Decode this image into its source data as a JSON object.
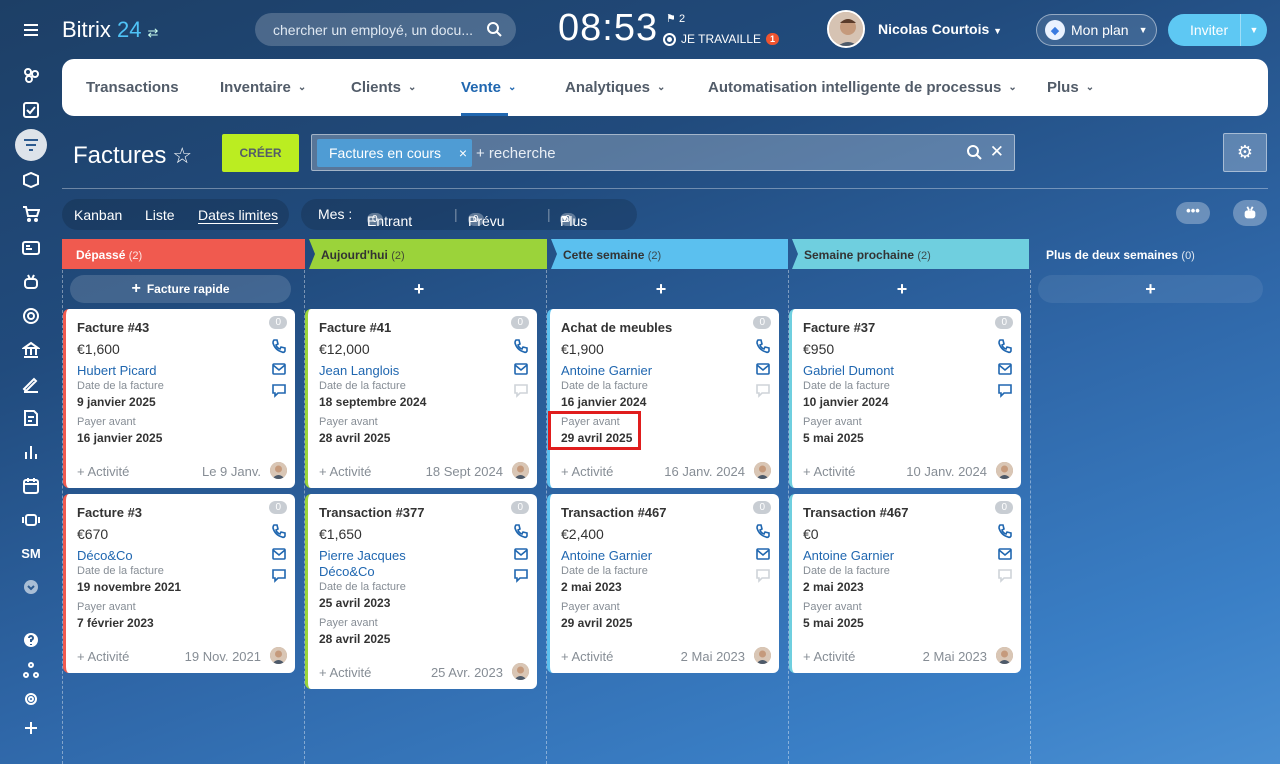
{
  "header": {
    "brand": "Bitrix",
    "brand_num": "24",
    "search_placeholder": "chercher un employé, un docu...",
    "clock": "08:53",
    "flag_count": "2",
    "work_status": "JE TRAVAILLE",
    "work_badge": "1",
    "user_name": "Nicolas Courtois",
    "plan_label": "Mon plan",
    "invite_label": "Inviter"
  },
  "sidebar": {
    "sm_label": "SM"
  },
  "tabs": [
    {
      "label": "Transactions"
    },
    {
      "label": "Inventaire"
    },
    {
      "label": "Clients"
    },
    {
      "label": "Vente"
    },
    {
      "label": "Analytiques"
    },
    {
      "label": "Automatisation intelligente de processus"
    },
    {
      "label": "Plus"
    }
  ],
  "page": {
    "title": "Factures",
    "create_label": "CRÉER",
    "filter_chip": "Factures en cours",
    "filter_placeholder": "+ recherche"
  },
  "views": {
    "kanban": "Kanban",
    "list": "Liste",
    "deadlines": "Dates limites"
  },
  "mes": {
    "label": "Mes :",
    "entrant_count": "0",
    "entrant": "Entrant",
    "prevu_count": "0",
    "prevu": "Prévu",
    "plus_count": "0",
    "plus": "Plus"
  },
  "columns": [
    {
      "title": "Dépassé",
      "count": "(2)",
      "color": "#f05a4f",
      "add_label": "Facture rapide"
    },
    {
      "title": "Aujourd'hui",
      "count": "(2)",
      "color": "#9bd33a",
      "add_label": "+"
    },
    {
      "title": "Cette semaine",
      "count": "(2)",
      "color": "#5bc0ef",
      "add_label": "+"
    },
    {
      "title": "Semaine prochaine",
      "count": "(2)",
      "color": "#6fcfdf",
      "add_label": "+"
    },
    {
      "title": "Plus de deux semaines",
      "count": "(0)",
      "color": "#3a6fa8",
      "add_label": "+"
    }
  ],
  "labels": {
    "invoice_date": "Date de la facture",
    "pay_before": "Payer avant",
    "activity": "+ Activité"
  },
  "cards": [
    {
      "title": "Facture #43",
      "count": "0",
      "amount": "€1,600",
      "client": "Hubert Picard",
      "client2": "",
      "invoice_date": "9 janvier 2025",
      "pay_before": "16 janvier 2025",
      "date": "Le 9 Janv."
    },
    {
      "title": "Facture #3",
      "count": "0",
      "amount": "€670",
      "client": "Déco&Co",
      "client2": "",
      "invoice_date": "19 novembre 2021",
      "pay_before": "7 février 2023",
      "date": "19 Nov. 2021"
    },
    {
      "title": "Facture #41",
      "count": "0",
      "amount": "€12,000",
      "client": "Jean Langlois",
      "client2": "",
      "invoice_date": "18 septembre 2024",
      "pay_before": "28 avril 2025",
      "date": "18 Sept 2024"
    },
    {
      "title": "Transaction #377",
      "count": "0",
      "amount": "€1,650",
      "client": "Pierre Jacques",
      "client2": "Déco&Co",
      "invoice_date": "25 avril 2023",
      "pay_before": "28 avril 2025",
      "date": "25 Avr. 2023"
    },
    {
      "title": "Achat de meubles",
      "count": "0",
      "amount": "€1,900",
      "client": "Antoine Garnier",
      "client2": "",
      "invoice_date": "16 janvier 2024",
      "pay_before": "29 avril 2025",
      "date": "16 Janv. 2024"
    },
    {
      "title": "Transaction #467",
      "count": "0",
      "amount": "€2,400",
      "client": "Antoine Garnier",
      "client2": "",
      "invoice_date": "2 mai 2023",
      "pay_before": "29 avril 2025",
      "date": "2 Mai 2023"
    },
    {
      "title": "Facture #37",
      "count": "0",
      "amount": "€950",
      "client": "Gabriel Dumont",
      "client2": "",
      "invoice_date": "10 janvier 2024",
      "pay_before": "5 mai 2025",
      "date": "10 Janv. 2024"
    },
    {
      "title": "Transaction #467",
      "count": "0",
      "amount": "€0",
      "client": "Antoine Garnier",
      "client2": "",
      "invoice_date": "2 mai 2023",
      "pay_before": "5 mai 2025",
      "date": "2 Mai 2023"
    }
  ]
}
